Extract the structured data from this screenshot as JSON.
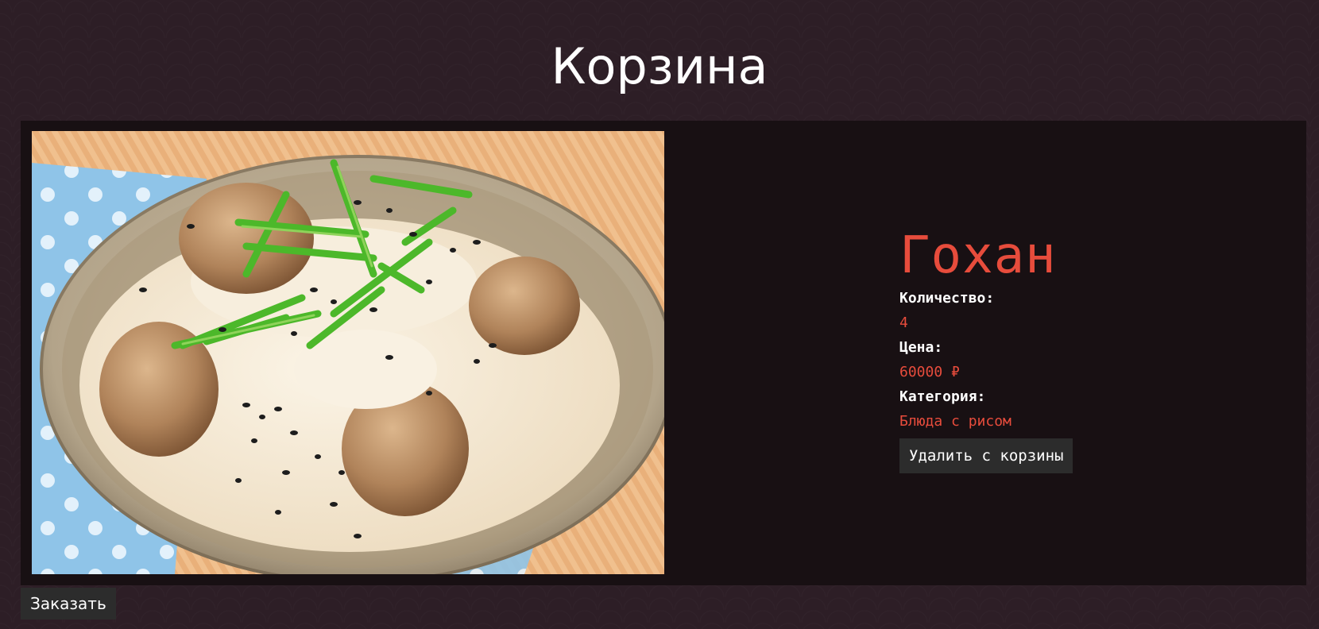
{
  "page": {
    "title": "Корзина"
  },
  "cart": {
    "items": [
      {
        "name": "Гохан",
        "quantity_label": "Количество:",
        "quantity": "4",
        "price_label": "Цена:",
        "price": "60000 ₽",
        "category_label": "Категория:",
        "category": "Блюда с рисом",
        "remove_label": "Удалить с корзины"
      }
    ]
  },
  "actions": {
    "order_label": "Заказать"
  },
  "colors": {
    "background": "#2d1e26",
    "card": "#181013",
    "accent": "#e74c3c",
    "button": "#2c2c2c",
    "text": "#ffffff"
  }
}
